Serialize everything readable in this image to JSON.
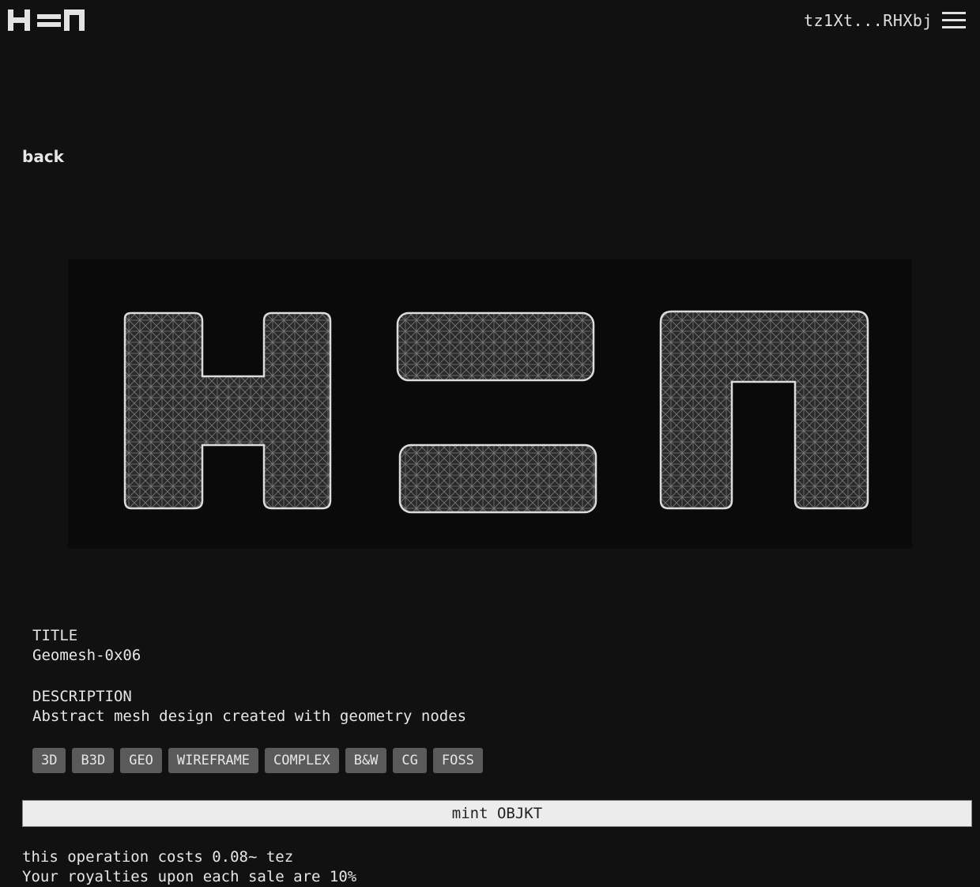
{
  "header": {
    "logo": "hen-logo",
    "wallet_address": "tz1Xt...RHXbj",
    "menu_icon": "hamburger-menu-icon"
  },
  "nav": {
    "back_label": "back"
  },
  "preview": {
    "alt": "wireframe mesh render of H=N letters"
  },
  "meta": {
    "title_label": "TITLE",
    "title_value": "Geomesh-0x06",
    "description_label": "DESCRIPTION",
    "description_value": "Abstract mesh design created with geometry nodes"
  },
  "tags": [
    "3D",
    "B3D",
    "GEO",
    "WIREFRAME",
    "COMPLEX",
    "B&W",
    "CG",
    "FOSS"
  ],
  "actions": {
    "mint_label": "mint OBJKT"
  },
  "info": {
    "cost_line": "this operation costs 0.08~ tez",
    "royalty_line": "Your royalties upon each sale are 10%"
  }
}
